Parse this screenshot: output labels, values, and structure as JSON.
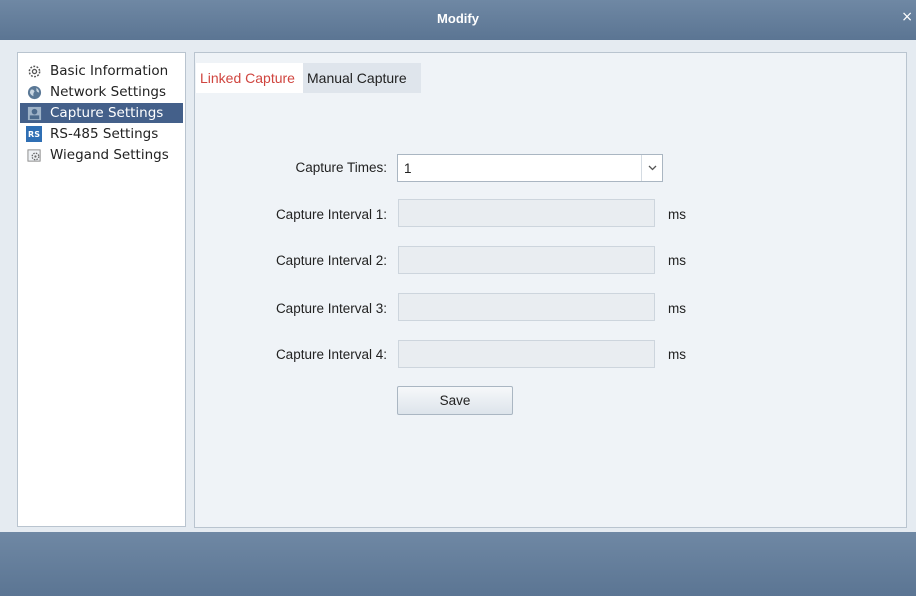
{
  "window": {
    "title": "Modify",
    "close_label": "×"
  },
  "sidebar": {
    "items": [
      {
        "label": "Basic Information",
        "icon": "gear-icon",
        "selected": false
      },
      {
        "label": "Network Settings",
        "icon": "globe-icon",
        "selected": false
      },
      {
        "label": "Capture Settings",
        "icon": "camera-icon",
        "selected": true
      },
      {
        "label": "RS-485 Settings",
        "icon": "rs-icon",
        "icon_text": "RS",
        "selected": false
      },
      {
        "label": "Wiegand Settings",
        "icon": "wiegand-gear-icon",
        "selected": false
      }
    ]
  },
  "tabs": [
    {
      "label": "Linked Capture",
      "active": true
    },
    {
      "label": "Manual Capture",
      "active": false
    }
  ],
  "form": {
    "capture_times": {
      "label": "Capture Times:",
      "value": "1"
    },
    "intervals": [
      {
        "label": "Capture Interval 1:",
        "value": "",
        "unit": "ms"
      },
      {
        "label": "Capture Interval 2:",
        "value": "",
        "unit": "ms"
      },
      {
        "label": "Capture Interval 3:",
        "value": "",
        "unit": "ms"
      },
      {
        "label": "Capture Interval 4:",
        "value": "",
        "unit": "ms"
      }
    ],
    "save_label": "Save"
  },
  "colors": {
    "titlebar": "#5b7593",
    "selected_nav": "#44608a",
    "active_tab_text": "#d0453f"
  }
}
